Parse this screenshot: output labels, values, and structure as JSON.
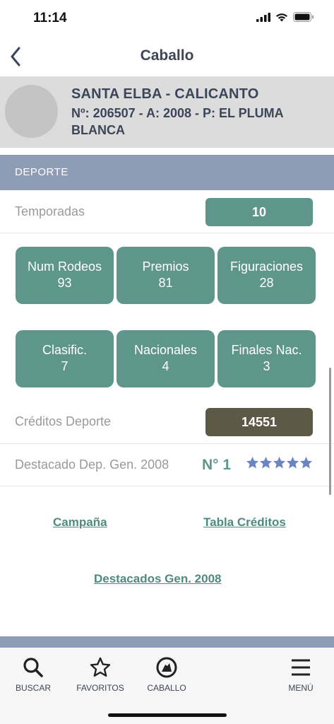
{
  "status": {
    "time": "11:14"
  },
  "nav": {
    "title": "Caballo"
  },
  "horse": {
    "name": "SANTA ELBA - CALICANTO",
    "details": "Nº: 206507 - A: 2008 - P: EL PLUMA BLANCA"
  },
  "section": {
    "title": "DEPORTE"
  },
  "temporadas": {
    "label": "Temporadas",
    "value": "10"
  },
  "stats_row1": [
    {
      "label": "Num Rodeos",
      "value": "93"
    },
    {
      "label": "Premios",
      "value": "81"
    },
    {
      "label": "Figuraciones",
      "value": "28"
    }
  ],
  "stats_row2": [
    {
      "label": "Clasific.",
      "value": "7"
    },
    {
      "label": "Nacionales",
      "value": "4"
    },
    {
      "label": "Finales Nac.",
      "value": "3"
    }
  ],
  "creditos": {
    "label": "Créditos Deporte",
    "value": "14551"
  },
  "destacado": {
    "label": "Destacado Dep. Gen. 2008",
    "rank": "N° 1",
    "stars": 5
  },
  "links": {
    "campana": "Campaña",
    "tabla": "Tabla Créditos",
    "destacados": "Destacados Gen. 2008"
  },
  "tabs": {
    "buscar": "BUSCAR",
    "favoritos": "FAVORITOS",
    "caballo": "CABALLO",
    "menu": "MENÚ"
  },
  "colors": {
    "accent": "#5e968b",
    "section": "#8e9cb6",
    "credits": "#5d5947",
    "star": "#6b84c2"
  }
}
